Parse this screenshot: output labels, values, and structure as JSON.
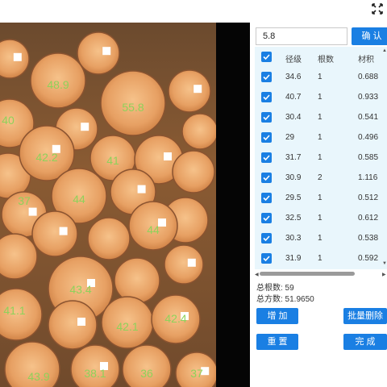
{
  "window": {
    "expand_icon": "expand-icon"
  },
  "input": {
    "value": "5.8"
  },
  "buttons": {
    "confirm": "确 认",
    "add": "增 加",
    "batch_delete": "批量删除",
    "reset": "重 置",
    "finish": "完 成"
  },
  "table": {
    "headers": [
      "径级",
      "根数",
      "材积"
    ],
    "rows": [
      {
        "diameter": "34.6",
        "count": "1",
        "volume": "0.688"
      },
      {
        "diameter": "40.7",
        "count": "1",
        "volume": "0.933"
      },
      {
        "diameter": "30.4",
        "count": "1",
        "volume": "0.541"
      },
      {
        "diameter": "29",
        "count": "1",
        "volume": "0.496"
      },
      {
        "diameter": "31.7",
        "count": "1",
        "volume": "0.585"
      },
      {
        "diameter": "30.9",
        "count": "2",
        "volume": "1.116"
      },
      {
        "diameter": "29.5",
        "count": "1",
        "volume": "0.512"
      },
      {
        "diameter": "32.5",
        "count": "1",
        "volume": "0.612"
      },
      {
        "diameter": "30.3",
        "count": "1",
        "volume": "0.538"
      },
      {
        "diameter": "31.9",
        "count": "1",
        "volume": "0.592"
      }
    ]
  },
  "summary": {
    "total_count": "总根数:  59",
    "total_volume": "总方数:  51.9650"
  },
  "photo_labels": [
    "48.9",
    "55.8",
    "40",
    "42.2",
    "41",
    "37",
    "44",
    "44",
    "43.4",
    "41.1",
    "42.1",
    "42.4",
    "43.9",
    "38.1",
    "36",
    "37"
  ]
}
